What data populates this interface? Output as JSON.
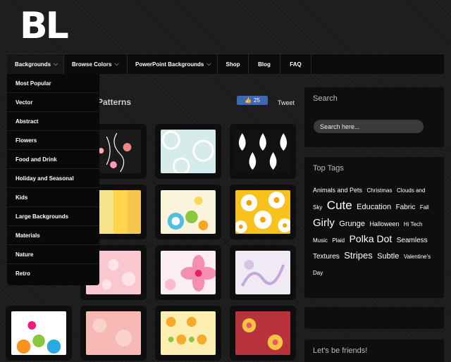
{
  "logo": {
    "text": "BL"
  },
  "nav": {
    "items": [
      {
        "label": "Backgrounds",
        "has_chevron": true
      },
      {
        "label": "Browse Colors",
        "has_chevron": true
      },
      {
        "label": "PowerPoint Backgrounds",
        "has_chevron": true
      },
      {
        "label": "Shop",
        "has_chevron": false
      },
      {
        "label": "Blog",
        "has_chevron": false
      },
      {
        "label": "FAQ",
        "has_chevron": false
      }
    ]
  },
  "dropdown": {
    "items": [
      "Most Popular",
      "Vector",
      "Abstract",
      "Flowers",
      "Food and Drink",
      "Holiday and Seasonal",
      "Kids",
      "Large Backgrounds",
      "Materials",
      "Nature",
      "Retro"
    ]
  },
  "main": {
    "heading": "Patterns",
    "like_count": "25",
    "tweet_label": "Tweet"
  },
  "sidebar": {
    "search_title": "Search",
    "search_placeholder": "Search here...",
    "tags_title": "Top Tags",
    "tags": [
      {
        "label": "Animals and Pets",
        "size": 9
      },
      {
        "label": "Christmas",
        "size": 8
      },
      {
        "label": "Clouds and Sky",
        "size": 8
      },
      {
        "label": "Cute",
        "size": 17
      },
      {
        "label": "Education",
        "size": 11
      },
      {
        "label": "Fabric",
        "size": 10
      },
      {
        "label": "Fall",
        "size": 8
      },
      {
        "label": "Girly",
        "size": 15
      },
      {
        "label": "Grunge",
        "size": 11
      },
      {
        "label": "Halloween",
        "size": 9
      },
      {
        "label": "Hi Tech",
        "size": 8
      },
      {
        "label": "Music",
        "size": 8
      },
      {
        "label": "Plaid",
        "size": 8
      },
      {
        "label": "Polka Dot",
        "size": 14
      },
      {
        "label": "Seamless",
        "size": 10
      },
      {
        "label": "Textures",
        "size": 10
      },
      {
        "label": "Stripes",
        "size": 13
      },
      {
        "label": "Subtle",
        "size": 11
      },
      {
        "label": "Valentine's Day",
        "size": 8
      }
    ],
    "friends_title": "Let's be friends!"
  },
  "colors": {
    "background": "#1c1c1c",
    "nav_bg": "#0b0b0b",
    "like_button": "#4267b2"
  }
}
